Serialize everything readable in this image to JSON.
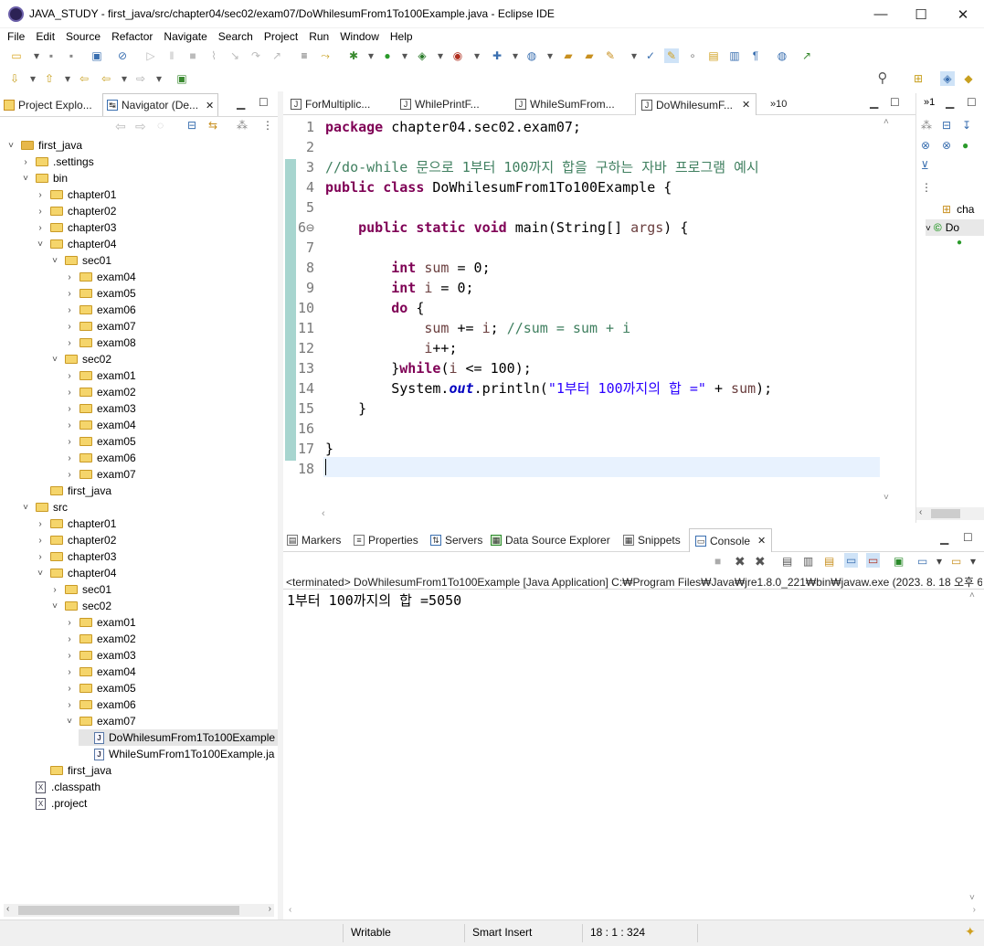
{
  "window": {
    "title": "JAVA_STUDY - first_java/src/chapter04/sec02/exam07/DoWhilesumFrom1To100Example.java - Eclipse IDE",
    "minimize": "—",
    "maximize": "☐",
    "close": "✕"
  },
  "menu": [
    "File",
    "Edit",
    "Source",
    "Refactor",
    "Navigate",
    "Search",
    "Project",
    "Run",
    "Window",
    "Help"
  ],
  "left_tabs": [
    {
      "label": "Project Explo..."
    },
    {
      "label": "Navigator (De..."
    }
  ],
  "tree": [
    {
      "label": "first_java",
      "depth": 0,
      "kind": "project",
      "expanded": true
    },
    {
      "label": ".settings",
      "depth": 1,
      "kind": "folder",
      "expanded": false
    },
    {
      "label": "bin",
      "depth": 1,
      "kind": "folder",
      "expanded": true
    },
    {
      "label": "chapter01",
      "depth": 2,
      "kind": "folder",
      "expanded": false
    },
    {
      "label": "chapter02",
      "depth": 2,
      "kind": "folder",
      "expanded": false
    },
    {
      "label": "chapter03",
      "depth": 2,
      "kind": "folder",
      "expanded": false
    },
    {
      "label": "chapter04",
      "depth": 2,
      "kind": "folder",
      "expanded": true
    },
    {
      "label": "sec01",
      "depth": 3,
      "kind": "folder",
      "expanded": true
    },
    {
      "label": "exam04",
      "depth": 4,
      "kind": "folder",
      "expanded": false
    },
    {
      "label": "exam05",
      "depth": 4,
      "kind": "folder",
      "expanded": false
    },
    {
      "label": "exam06",
      "depth": 4,
      "kind": "folder",
      "expanded": false
    },
    {
      "label": "exam07",
      "depth": 4,
      "kind": "folder",
      "expanded": false
    },
    {
      "label": "exam08",
      "depth": 4,
      "kind": "folder",
      "expanded": false
    },
    {
      "label": "sec02",
      "depth": 3,
      "kind": "folder",
      "expanded": true
    },
    {
      "label": "exam01",
      "depth": 4,
      "kind": "folder",
      "expanded": false
    },
    {
      "label": "exam02",
      "depth": 4,
      "kind": "folder",
      "expanded": false
    },
    {
      "label": "exam03",
      "depth": 4,
      "kind": "folder",
      "expanded": false
    },
    {
      "label": "exam04",
      "depth": 4,
      "kind": "folder",
      "expanded": false
    },
    {
      "label": "exam05",
      "depth": 4,
      "kind": "folder",
      "expanded": false
    },
    {
      "label": "exam06",
      "depth": 4,
      "kind": "folder",
      "expanded": false
    },
    {
      "label": "exam07",
      "depth": 4,
      "kind": "folder",
      "expanded": false
    },
    {
      "label": "first_java",
      "depth": 2,
      "kind": "folder",
      "expanded": null
    },
    {
      "label": "src",
      "depth": 1,
      "kind": "folder",
      "expanded": true
    },
    {
      "label": "chapter01",
      "depth": 2,
      "kind": "folder",
      "expanded": false
    },
    {
      "label": "chapter02",
      "depth": 2,
      "kind": "folder",
      "expanded": false
    },
    {
      "label": "chapter03",
      "depth": 2,
      "kind": "folder",
      "expanded": false
    },
    {
      "label": "chapter04",
      "depth": 2,
      "kind": "folder",
      "expanded": true
    },
    {
      "label": "sec01",
      "depth": 3,
      "kind": "folder",
      "expanded": false
    },
    {
      "label": "sec02",
      "depth": 3,
      "kind": "folder",
      "expanded": true
    },
    {
      "label": "exam01",
      "depth": 4,
      "kind": "folder",
      "expanded": false
    },
    {
      "label": "exam02",
      "depth": 4,
      "kind": "folder",
      "expanded": false
    },
    {
      "label": "exam03",
      "depth": 4,
      "kind": "folder",
      "expanded": false
    },
    {
      "label": "exam04",
      "depth": 4,
      "kind": "folder",
      "expanded": false
    },
    {
      "label": "exam05",
      "depth": 4,
      "kind": "folder",
      "expanded": false
    },
    {
      "label": "exam06",
      "depth": 4,
      "kind": "folder",
      "expanded": false
    },
    {
      "label": "exam07",
      "depth": 4,
      "kind": "folder",
      "expanded": true
    },
    {
      "label": "DoWhilesumFrom1To100Example",
      "depth": 5,
      "kind": "java",
      "expanded": null,
      "selected": true
    },
    {
      "label": "WhileSumFrom1To100Example.ja",
      "depth": 5,
      "kind": "java",
      "expanded": null
    },
    {
      "label": "first_java",
      "depth": 2,
      "kind": "folder",
      "expanded": null
    },
    {
      "label": ".classpath",
      "depth": 1,
      "kind": "xml",
      "expanded": null
    },
    {
      "label": ".project",
      "depth": 1,
      "kind": "xml",
      "expanded": null
    }
  ],
  "editor_tabs": [
    {
      "label": "ForMultiplic..."
    },
    {
      "label": "WhilePrintF..."
    },
    {
      "label": "WhileSumFrom..."
    },
    {
      "label": "DoWhilesumF...",
      "active": true
    }
  ],
  "editor_tabs_overflow": "»10",
  "code_lines": [
    {
      "n": "1",
      "html": "<span class='kw'>package</span> chapter04.sec02.exam07;"
    },
    {
      "n": "2",
      "html": ""
    },
    {
      "n": "3",
      "html": "<span class='cm'>//do-while 문으로 1부터 100까지 합을 구하는 자바 프로그램 예시</span>"
    },
    {
      "n": "4",
      "html": "<span class='kw'>public</span> <span class='kw'>class</span> DoWhilesumFrom1To100Example {"
    },
    {
      "n": "5",
      "html": ""
    },
    {
      "n": "6⊖",
      "html": "    <span class='kw'>public</span> <span class='kw'>static</span> <span class='kw'>void</span> main(String[] <span class='var'>args</span>) {"
    },
    {
      "n": "7",
      "html": ""
    },
    {
      "n": "8",
      "html": "        <span class='kw'>int</span> <span class='var'>sum</span> = 0;"
    },
    {
      "n": "9",
      "html": "        <span class='kw'>int</span> <span class='var'>i</span> = 0;"
    },
    {
      "n": "10",
      "html": "        <span class='kw'>do</span> {"
    },
    {
      "n": "11",
      "html": "            <span class='var'>sum</span> += <span class='var'>i</span>; <span class='cm'>//sum = sum + i</span>"
    },
    {
      "n": "12",
      "html": "            <span class='var'>i</span>++;"
    },
    {
      "n": "13",
      "html": "        }<span class='kw'>while</span>(<span class='var'>i</span> &lt;= 100);"
    },
    {
      "n": "14",
      "html": "        System.<span class='fld'>out</span>.println(<span class='str'>\"1부터 100까지의 합 =\"</span> + <span class='var'>sum</span>);"
    },
    {
      "n": "15",
      "html": "    }"
    },
    {
      "n": "16",
      "html": ""
    },
    {
      "n": "17",
      "html": "}"
    },
    {
      "n": "18",
      "html": ""
    }
  ],
  "bottom_tabs": [
    {
      "label": "Markers"
    },
    {
      "label": "Properties"
    },
    {
      "label": "Servers"
    },
    {
      "label": "Data Source Explorer"
    },
    {
      "label": "Snippets"
    },
    {
      "label": "Console",
      "active": true
    }
  ],
  "console": {
    "header": "<terminated> DoWhilesumFrom1To100Example [Java Application] C:₩Program Files₩Java₩jre1.8.0_221₩bin₩javaw.exe  (2023. 8. 18 오후 6",
    "output": "1부터 100까지의 합 =5050"
  },
  "outline": {
    "items": [
      {
        "label": "cha"
      },
      {
        "label": "Do"
      }
    ],
    "tab_label": "»1"
  },
  "status": {
    "writable": "Writable",
    "insert_mode": "Smart Insert",
    "position": "18 : 1 : 324"
  }
}
